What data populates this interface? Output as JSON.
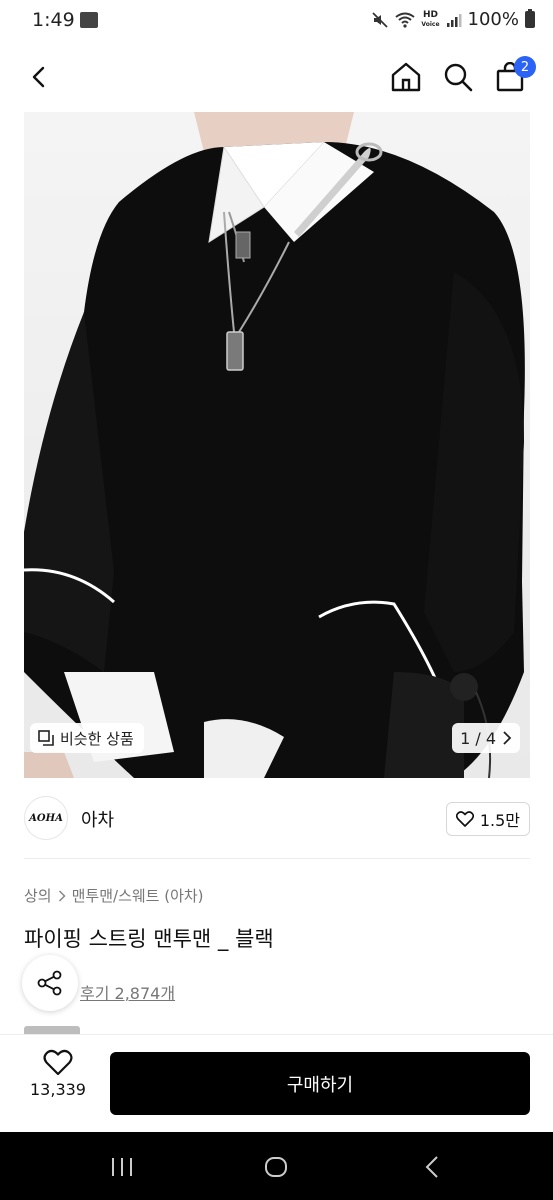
{
  "status_bar": {
    "time": "1:49",
    "battery": "100%",
    "hd_label_1": "HD",
    "hd_label_2": "Voice"
  },
  "nav": {
    "cart_count": "2",
    "icons": [
      "back-arrow-icon",
      "home-icon",
      "search-icon",
      "shopping-bag-icon"
    ]
  },
  "gallery": {
    "similar_label": "비슷한 상품",
    "page_indicator": "1 / 4"
  },
  "brand": {
    "logo_text": "AOHA",
    "name": "아차",
    "likes": "1.5만"
  },
  "breadcrumb": {
    "category": "상의",
    "subcategory": "맨투맨/스웨트 (아차)"
  },
  "product": {
    "title": "파이핑 스트링 맨투맨 _ 블랙",
    "reviews": "후기 2,874개"
  },
  "bottom_bar": {
    "wish_count": "13,339",
    "buy_label": "구매하기"
  },
  "colors": {
    "accent_badge": "#2a63f6",
    "buy_button": "#000000"
  }
}
